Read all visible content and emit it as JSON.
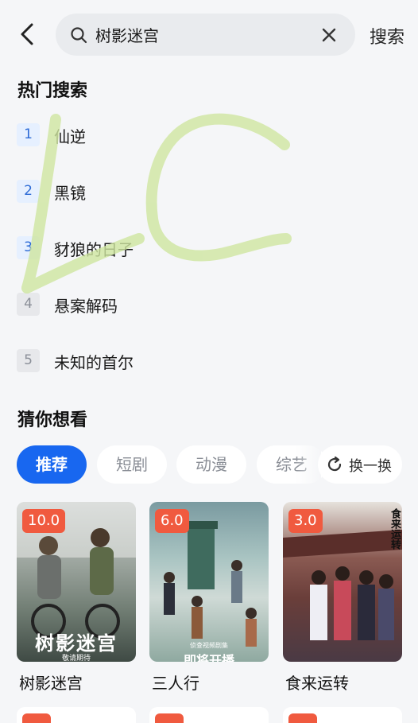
{
  "search": {
    "query": "树影迷宫",
    "submit_label": "搜索"
  },
  "hot": {
    "title": "热门搜索",
    "items": [
      {
        "rank": "1",
        "label": "仙逆"
      },
      {
        "rank": "2",
        "label": "黑镜"
      },
      {
        "rank": "3",
        "label": "豺狼的日子"
      },
      {
        "rank": "4",
        "label": "悬案解码"
      },
      {
        "rank": "5",
        "label": "未知的首尔"
      }
    ]
  },
  "guess": {
    "title": "猜你想看",
    "chips": [
      "推荐",
      "短剧",
      "动漫",
      "综艺"
    ],
    "refresh_label": "换一换",
    "cards": [
      {
        "score": "10.0",
        "title": "树影迷宫",
        "poster_text": "树影迷宫",
        "poster_sub": "敬请期待"
      },
      {
        "score": "6.0",
        "title": "三人行",
        "poster_text": "即将开播",
        "poster_sub": "侦查视频剧集"
      },
      {
        "score": "3.0",
        "title": "食来运转",
        "poster_text": "食来运转",
        "poster_sub": ""
      }
    ]
  },
  "colors": {
    "accent": "#1867f0",
    "score_badge": "#f05a3f",
    "background": "#f5f6f8",
    "watermark": "#cfe6a0"
  },
  "icons": {
    "back": "chevron-left-icon",
    "search": "search-icon",
    "clear": "close-icon",
    "refresh": "refresh-icon"
  }
}
